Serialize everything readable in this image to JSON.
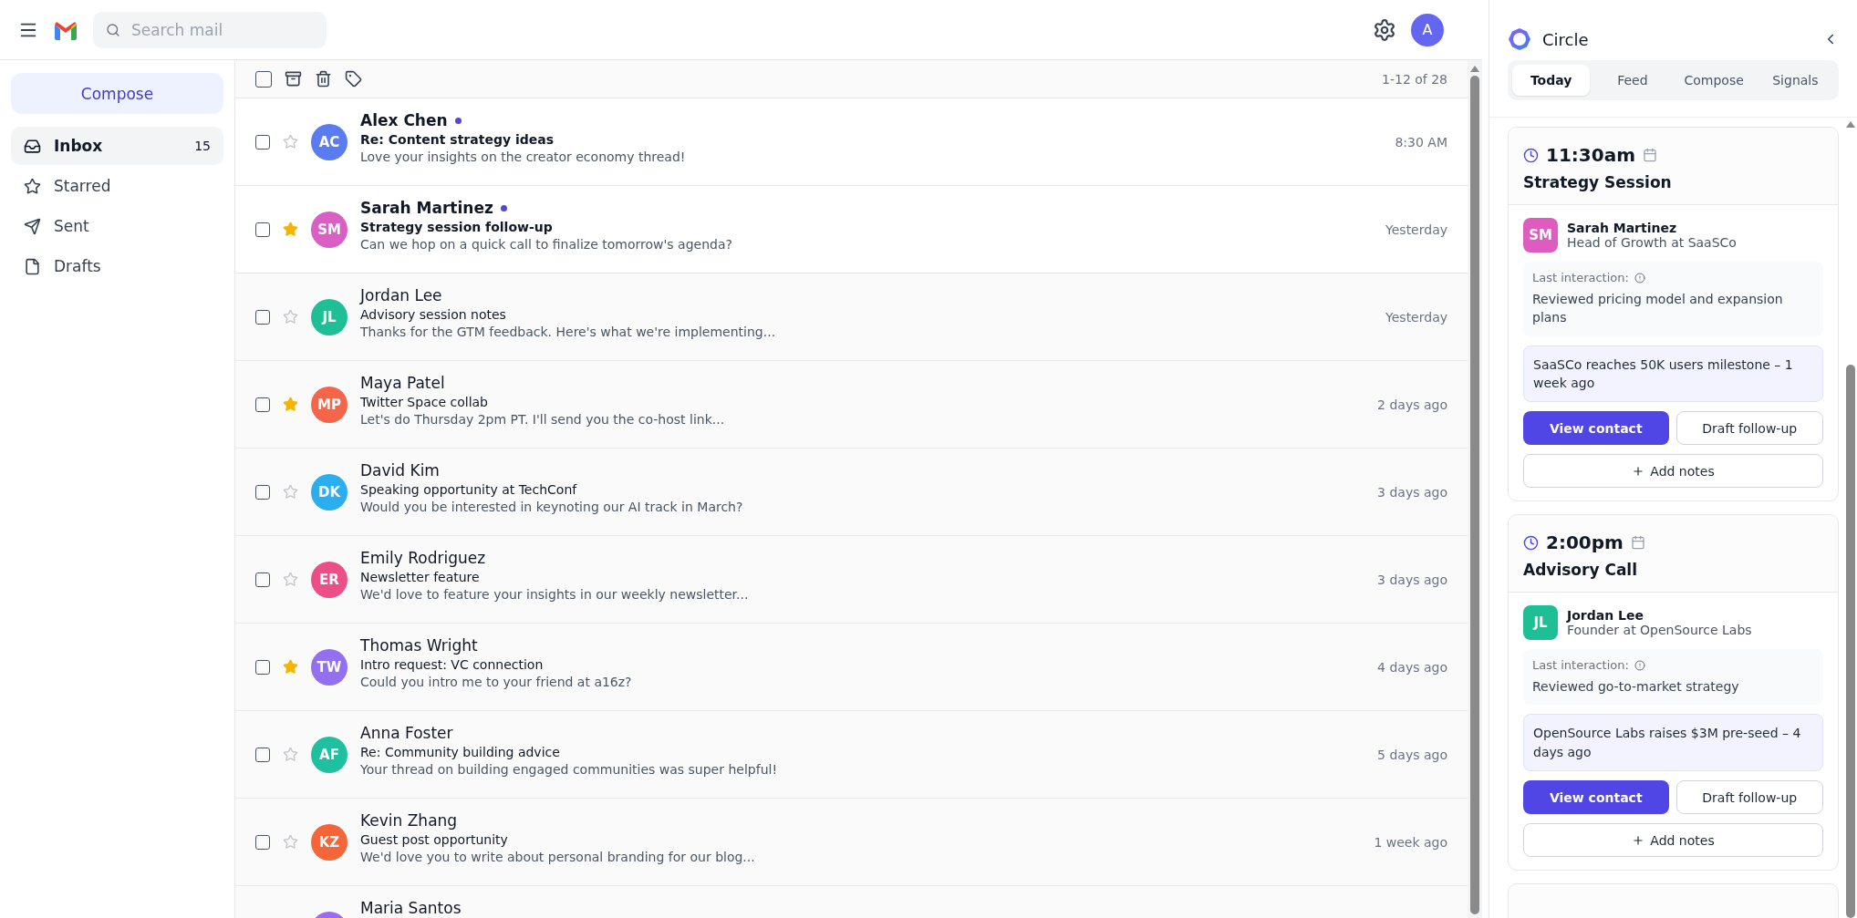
{
  "header": {
    "search_placeholder": "Search mail",
    "avatar": "A"
  },
  "sidebar": {
    "compose": "Compose",
    "items": [
      {
        "kind": "inbox",
        "label": "Inbox",
        "count": "15",
        "selected": true
      },
      {
        "kind": "starred",
        "label": "Starred",
        "selected": false
      },
      {
        "kind": "sent",
        "label": "Sent",
        "selected": false
      },
      {
        "kind": "drafts",
        "label": "Drafts",
        "selected": false
      }
    ]
  },
  "toolbar": {
    "select_all_checked": false,
    "range": "1-12 of 28"
  },
  "emails": [
    {
      "sender": "Alex Chen",
      "subject": "Re: Content strategy ideas",
      "snippet": "Love your insights on the creator economy thread!",
      "time": "8:30 AM",
      "initials": "AC",
      "color": "#5b7cf0",
      "unread": true,
      "starred": false
    },
    {
      "sender": "Sarah Martinez",
      "subject": "Strategy session follow-up",
      "snippet": "Can we hop on a quick call to finalize tomorrow's agenda?",
      "time": "Yesterday",
      "initials": "SM",
      "color": "#d95fc4",
      "unread": true,
      "starred": true
    },
    {
      "sender": "Jordan Lee",
      "subject": "Advisory session notes",
      "snippet": "Thanks for the GTM feedback. Here's what we're implementing...",
      "time": "Yesterday",
      "initials": "JL",
      "color": "#1fbf95",
      "unread": false,
      "starred": false
    },
    {
      "sender": "Maya Patel",
      "subject": "Twitter Space collab",
      "snippet": "Let's do Thursday 2pm PT. I'll send you the co-host link...",
      "time": "2 days ago",
      "initials": "MP",
      "color": "#f4654a",
      "unread": false,
      "starred": true
    },
    {
      "sender": "David Kim",
      "subject": "Speaking opportunity at TechConf",
      "snippet": "Would you be interested in keynoting our AI track in March?",
      "time": "3 days ago",
      "initials": "DK",
      "color": "#2aaef0",
      "unread": false,
      "starred": false
    },
    {
      "sender": "Emily Rodriguez",
      "subject": "Newsletter feature",
      "snippet": "We'd love to feature your insights in our weekly newsletter...",
      "time": "3 days ago",
      "initials": "ER",
      "color": "#ec4f86",
      "unread": false,
      "starred": false
    },
    {
      "sender": "Thomas Wright",
      "subject": "Intro request: VC connection",
      "snippet": "Could you intro me to your friend at a16z?",
      "time": "4 days ago",
      "initials": "TW",
      "color": "#9270f0",
      "unread": false,
      "starred": true
    },
    {
      "sender": "Anna Foster",
      "subject": "Re: Community building advice",
      "snippet": "Your thread on building engaged communities was super helpful!",
      "time": "5 days ago",
      "initials": "AF",
      "color": "#1fc0a0",
      "unread": false,
      "starred": false
    },
    {
      "sender": "Kevin Zhang",
      "subject": "Guest post opportunity",
      "snippet": "We'd love you to write about personal branding for our blog...",
      "time": "1 week ago",
      "initials": "KZ",
      "color": "#f5653a",
      "unread": false,
      "starred": false
    },
    {
      "sender": "Maria Santos",
      "color": "#9b6cf0",
      "unread": false
    }
  ],
  "panel": {
    "title": "Circle",
    "tabs": [
      {
        "label": "Today",
        "selected": true
      },
      {
        "label": "Feed",
        "selected": false
      },
      {
        "label": "Compose",
        "selected": false
      },
      {
        "label": "Signals",
        "selected": false
      }
    ],
    "events": [
      {
        "time": "11:30am",
        "title": "Strategy Session",
        "contact": {
          "initials": "SM",
          "color": "#de5cc0",
          "name": "Sarah Martinez",
          "role": "Head of Growth at SaaSCo"
        },
        "last_label": "Last interaction:",
        "last_text": "Reviewed pricing model and expansion plans",
        "signal": "SaaSCo reaches 50K users milestone – 1 week ago",
        "primary": "View contact",
        "secondary": "Draft follow-up",
        "notes": "Add notes"
      },
      {
        "time": "2:00pm",
        "title": "Advisory Call",
        "contact": {
          "initials": "JL",
          "color": "#1fbf95",
          "name": "Jordan Lee",
          "role": "Founder at OpenSource Labs"
        },
        "last_label": "Last interaction:",
        "last_text": "Reviewed go-to-market strategy",
        "signal": "OpenSource Labs raises $3M pre-seed – 4 days ago",
        "primary": "View contact",
        "secondary": "Draft follow-up",
        "notes": "Add notes"
      }
    ]
  }
}
